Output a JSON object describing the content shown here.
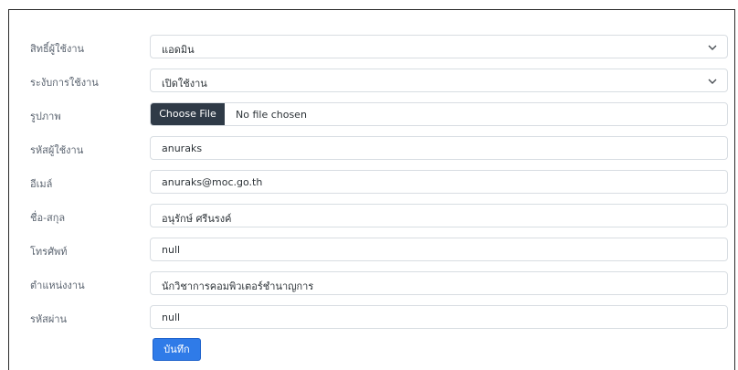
{
  "form": {
    "role": {
      "label": "สิทธิ์ผู้ใช้งาน",
      "value": "แอดมิน"
    },
    "status": {
      "label": "ระงับการใช้งาน",
      "value": "เปิดใช้งาน"
    },
    "image": {
      "label": "รูปภาพ",
      "button_label": "Choose File",
      "file_name": "No file chosen"
    },
    "username": {
      "label": "รหัสผู้ใช้งาน",
      "value": "anuraks"
    },
    "email": {
      "label": "อีเมล์",
      "value": "anuraks@moc.go.th"
    },
    "fullname": {
      "label": "ชื่อ-สกุล",
      "value": "อนุรักษ์ ศรีนรงค์"
    },
    "phone": {
      "label": "โทรศัพท์",
      "value": "null"
    },
    "position": {
      "label": "ตำแหน่งงาน",
      "value": "นักวิชาการคอมพิวเตอร์ชำนาญการ"
    },
    "password": {
      "label": "รหัสผ่าน",
      "value": "null"
    },
    "save_label": "บันทึก"
  },
  "icons": {
    "select_arrow": "chevron-down-icon"
  },
  "colors": {
    "primary": "#2f7be8",
    "file_button": "#2f3a47",
    "border": "#d8dde2"
  }
}
